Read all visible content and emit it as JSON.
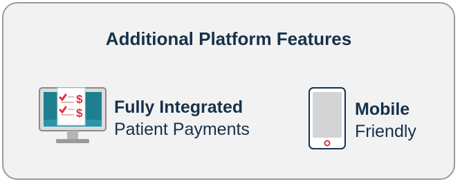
{
  "card": {
    "title": "Additional Platform Features"
  },
  "features": [
    {
      "bold": "Fully Integrated",
      "normal": "Patient Payments",
      "icon": "monitor-payments-icon"
    },
    {
      "bold": "Mobile",
      "normal": "Friendly",
      "icon": "tablet-icon"
    }
  ],
  "colors": {
    "background": "#f2f2f2",
    "border": "#9a9a9a",
    "text": "#17314a",
    "accent_teal": "#1e7f8f",
    "accent_red": "#e0303f"
  }
}
